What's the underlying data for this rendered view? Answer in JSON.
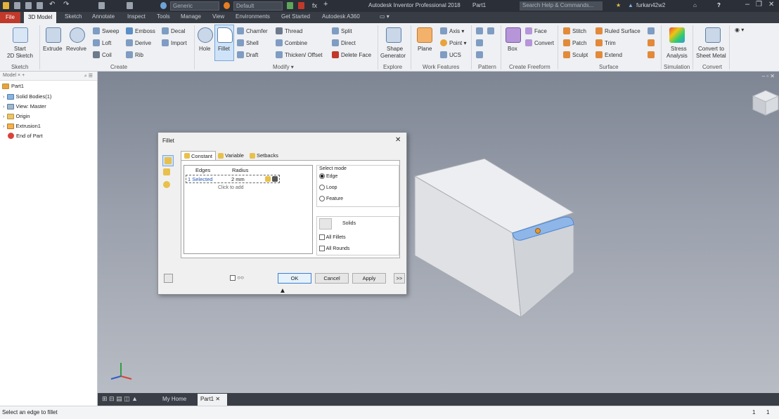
{
  "titlebar": {
    "appearance_dropdown": "Generic",
    "style_dropdown": "Default",
    "title": "Autodesk Inventor Professional 2018",
    "doc": "Part1",
    "search_placeholder": "Search Help & Commands...",
    "user": "furkan42w2"
  },
  "tabs": [
    "File",
    "3D Model",
    "Sketch",
    "Annotate",
    "Inspect",
    "Tools",
    "Manage",
    "View",
    "Environments",
    "Get Started",
    "Autodesk A360"
  ],
  "ribbon": {
    "sketch": {
      "start": "Start",
      "sketch2d": "2D Sketch",
      "panel": "Sketch"
    },
    "create": {
      "extrude": "Extrude",
      "revolve": "Revolve",
      "sweep": "Sweep",
      "loft": "Loft",
      "coil": "Coil",
      "emboss": "Emboss",
      "derive": "Derive",
      "rib": "Rib",
      "decal": "Decal",
      "import": "Import",
      "panel": "Create"
    },
    "modify": {
      "hole": "Hole",
      "fillet": "Fillet",
      "chamfer": "Chamfer",
      "shell": "Shell",
      "draft": "Draft",
      "thread": "Thread",
      "combine": "Combine",
      "thicken": "Thicken/ Offset",
      "split": "Split",
      "direct": "Direct",
      "delete_face": "Delete Face",
      "panel": "Modify ▾"
    },
    "explore": {
      "shape1": "Shape",
      "shape2": "Generator",
      "panel": "Explore"
    },
    "work": {
      "plane": "Plane",
      "axis": "Axis ▾",
      "point": "Point ▾",
      "ucs": "UCS",
      "panel": "Work Features"
    },
    "pattern": {
      "panel": "Pattern"
    },
    "freeform": {
      "box": "Box",
      "face": "Face",
      "convert": "Convert",
      "panel": "Create Freeform"
    },
    "surface": {
      "stitch": "Stitch",
      "patch": "Patch",
      "sculpt": "Sculpt",
      "ruled": "Ruled Surface",
      "trim": "Trim",
      "extend": "Extend",
      "panel": "Surface"
    },
    "simulation": {
      "stress1": "Stress",
      "stress2": "Analysis",
      "panel": "Simulation"
    },
    "convert": {
      "c1": "Convert to",
      "c2": "Sheet Metal",
      "panel": "Convert"
    }
  },
  "browser": {
    "tab": "Model",
    "root": "Part1",
    "items": [
      "Solid Bodies(1)",
      "View: Master",
      "Origin",
      "Extrusion1",
      "End of Part"
    ]
  },
  "dialog": {
    "title": "Fillet",
    "tabs": [
      "Constant",
      "Variable",
      "Setbacks"
    ],
    "col_edges": "Edges",
    "col_radius": "Radius",
    "row_edges": "1 Selected",
    "row_radius": "2 mm",
    "click_to_add": "Click to add",
    "select_mode": "Select mode",
    "modes": [
      "Edge",
      "Loop",
      "Feature"
    ],
    "selected_mode": "Edge",
    "solids": "Solids",
    "all_fillets": "All Fillets",
    "all_rounds": "All Rounds",
    "ok": "OK",
    "cancel": "Cancel",
    "apply": "Apply",
    "more": ">>"
  },
  "doctabs": {
    "home": "My Home",
    "part": "Part1"
  },
  "status": {
    "message": "Select an edge to fillet",
    "n1": "1",
    "n2": "1"
  }
}
